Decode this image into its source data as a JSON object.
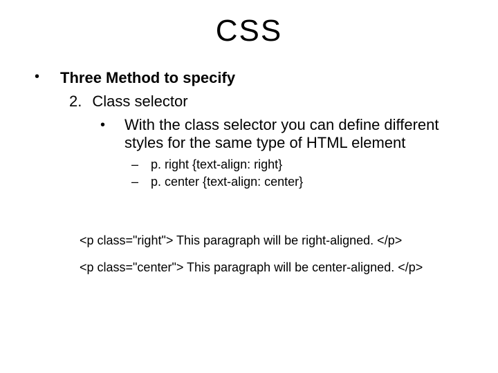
{
  "title": "CSS",
  "level1": {
    "text": "Three Method to specify"
  },
  "level2": {
    "num": "2.",
    "text": "Class selector"
  },
  "level3": {
    "text": "With the class selector you can define different styles for the same type of HTML element"
  },
  "level4a": {
    "text": "p. right {text-align: right}"
  },
  "level4b": {
    "text": "p. center {text-align: center}"
  },
  "example1": "<p class=\"right\"> This paragraph will be right-aligned. </p>",
  "example2": "<p class=\"center\"> This paragraph will be center-aligned. </p>"
}
